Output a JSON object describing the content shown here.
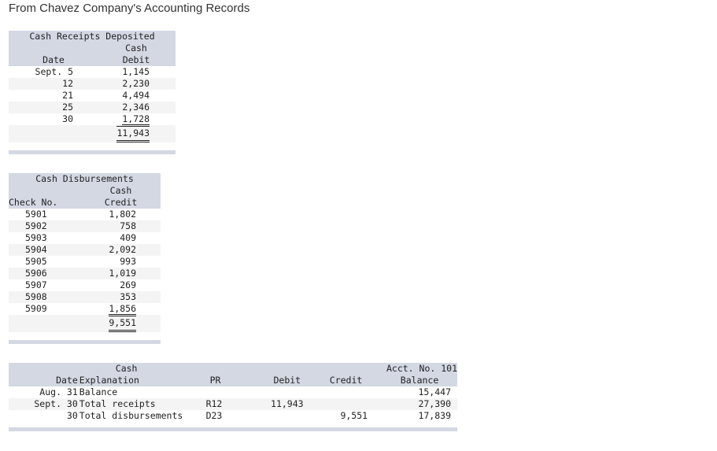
{
  "title": "From Chavez Company's Accounting Records",
  "receipts": {
    "heading": "Cash Receipts Deposited",
    "col_header_cash": "Cash",
    "col_date": "Date",
    "col_debit": "Debit",
    "rows": [
      {
        "date": "Sept. 5",
        "amount": "1,145"
      },
      {
        "date": "12",
        "amount": "2,230"
      },
      {
        "date": "21",
        "amount": "4,494"
      },
      {
        "date": "25",
        "amount": "2,346"
      },
      {
        "date": "30",
        "amount": "1,728"
      }
    ],
    "total": "11,943"
  },
  "disbursements": {
    "heading": "Cash Disbursements",
    "col_header_cash": "Cash",
    "col_check": "Check No.",
    "col_credit": "Credit",
    "rows": [
      {
        "check": "5901",
        "amount": "1,802"
      },
      {
        "check": "5902",
        "amount": "758"
      },
      {
        "check": "5903",
        "amount": "409"
      },
      {
        "check": "5904",
        "amount": "2,092"
      },
      {
        "check": "5905",
        "amount": "993"
      },
      {
        "check": "5906",
        "amount": "1,019"
      },
      {
        "check": "5907",
        "amount": "269"
      },
      {
        "check": "5908",
        "amount": "353"
      },
      {
        "check": "5909",
        "amount": "1,856"
      }
    ],
    "total": "9,551"
  },
  "ledger": {
    "heading": "Cash",
    "acct": "Acct. No. 101",
    "col_date": "Date",
    "col_explanation": "Explanation",
    "col_pr": "PR",
    "col_debit": "Debit",
    "col_credit": "Credit",
    "col_balance": "Balance",
    "rows": [
      {
        "date": "Aug. 31",
        "explanation": "Balance",
        "pr": "",
        "debit": "",
        "credit": "",
        "balance": "15,447"
      },
      {
        "date": "Sept. 30",
        "explanation": "Total receipts",
        "pr": "R12",
        "debit": "11,943",
        "credit": "",
        "balance": "27,390"
      },
      {
        "date": "30",
        "explanation": "Total disbursements",
        "pr": "D23",
        "debit": "",
        "credit": "9,551",
        "balance": "17,839"
      }
    ]
  }
}
